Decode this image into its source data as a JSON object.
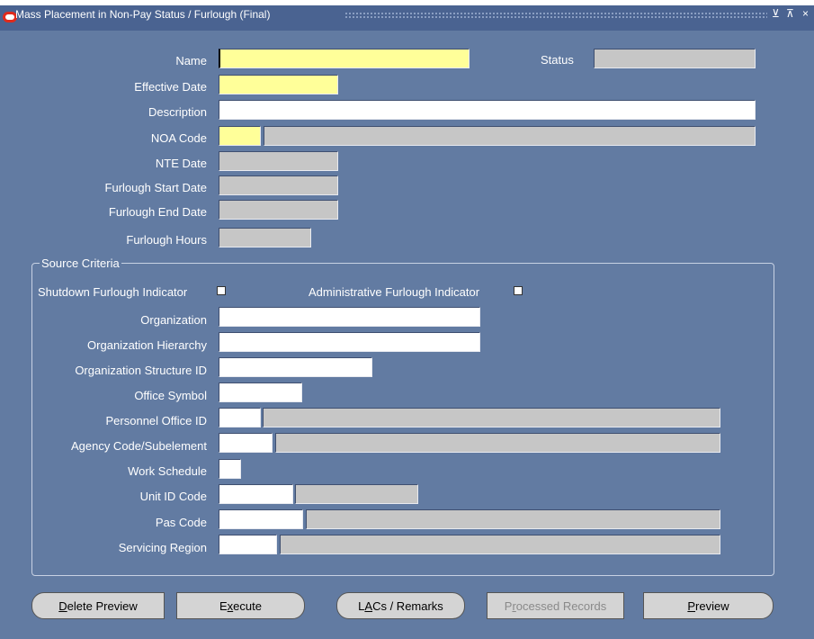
{
  "window": {
    "title": "Mass Placement in Non-Pay Status / Furlough (Final)",
    "controls": [
      "⊻",
      "⊼",
      "×"
    ]
  },
  "header": {
    "name_label": "Name",
    "status_label": "Status",
    "effective_date_label": "Effective Date",
    "description_label": "Description",
    "noa_code_label": "NOA Code",
    "nte_date_label": "NTE Date",
    "furlough_start_label": "Furlough Start Date",
    "furlough_end_label": "Furlough End Date",
    "furlough_hours_label": "Furlough Hours"
  },
  "source_criteria": {
    "legend": "Source Criteria",
    "shutdown_label": "Shutdown Furlough Indicator",
    "admin_label": "Administrative Furlough Indicator",
    "organization_label": "Organization",
    "org_hierarchy_label": "Organization Hierarchy",
    "org_structure_label": "Organization Structure ID",
    "office_symbol_label": "Office Symbol",
    "personnel_office_label": "Personnel Office ID",
    "agency_code_label": "Agency Code/Subelement",
    "work_schedule_label": "Work Schedule",
    "unit_id_label": "Unit ID Code",
    "pas_code_label": "Pas Code",
    "servicing_region_label": "Servicing Region"
  },
  "buttons": {
    "delete_preview": {
      "pre": "",
      "key": "D",
      "post": "elete Preview"
    },
    "execute": {
      "pre": "E",
      "key": "x",
      "post": "ecute"
    },
    "lacs": {
      "pre": "L",
      "key": "A",
      "post": "Cs / Remarks"
    },
    "processed": {
      "pre": "P",
      "key": "r",
      "post": "ocessed Records"
    },
    "preview": {
      "pre": "",
      "key": "P",
      "post": "review"
    }
  },
  "colors": {
    "background": "#627ba2",
    "required_field": "#ffff99",
    "readonly_field": "#c6c6c6"
  }
}
